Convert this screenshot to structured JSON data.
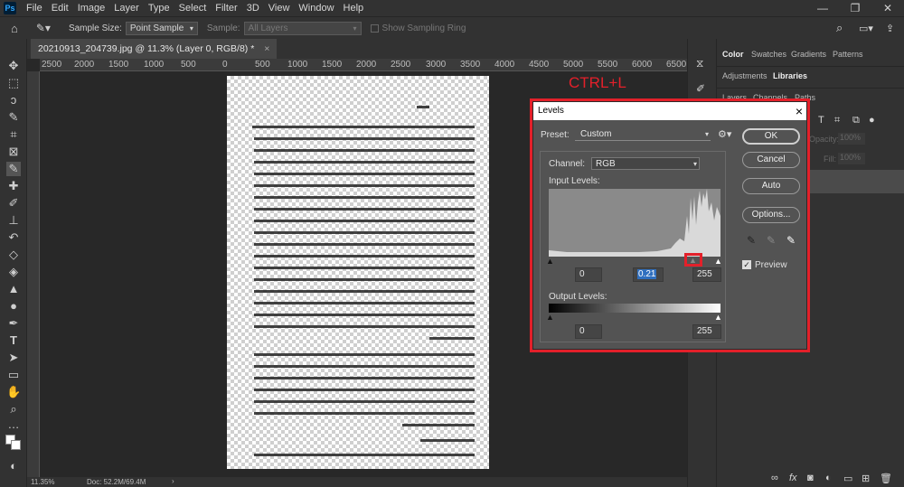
{
  "menubar": {
    "app_logo": "Ps",
    "items": [
      "File",
      "Edit",
      "Image",
      "Layer",
      "Type",
      "Select",
      "Filter",
      "3D",
      "View",
      "Window",
      "Help"
    ],
    "window_controls": [
      "—",
      "❐",
      "✕"
    ]
  },
  "options_bar": {
    "sample_size_label": "Sample Size:",
    "sample_size_value": "Point Sample",
    "sample_label": "Sample:",
    "sample_value": "All Layers",
    "show_ring_label": "Show Sampling Ring"
  },
  "document": {
    "tab_title": "20210913_204739.jpg @ 11.3% (Layer 0, RGB/8) *",
    "ruler_ticks": [
      "2500",
      "2000",
      "1500",
      "1000",
      "500",
      "0",
      "500",
      "1000",
      "1500",
      "2000",
      "2500",
      "3000",
      "3500",
      "4000",
      "4500",
      "5000",
      "5500",
      "6000",
      "6500"
    ],
    "zoom": "11.35%",
    "doc_size": "Doc: 52.2M/69.4M"
  },
  "annotation": {
    "shortcut": "CTRL+L"
  },
  "panels": {
    "top_tabs": [
      "Color",
      "Swatches",
      "Gradients",
      "Patterns"
    ],
    "second_tabs": [
      "Adjustments",
      "Libraries"
    ],
    "layer_tabs": [
      "Layers",
      "Channels",
      "Paths"
    ],
    "opacity_label": "Opacity:",
    "opacity_value": "100%",
    "fill_label": "Fill:",
    "fill_value": "100%"
  },
  "levels_dialog": {
    "title": "Levels",
    "preset_label": "Preset:",
    "preset_value": "Custom",
    "channel_label": "Channel:",
    "channel_value": "RGB",
    "input_levels_label": "Input Levels:",
    "input_black": "0",
    "input_gray": "0.21",
    "input_white": "255",
    "output_levels_label": "Output Levels:",
    "output_black": "0",
    "output_white": "255",
    "buttons": {
      "ok": "OK",
      "cancel": "Cancel",
      "auto": "Auto",
      "options": "Options..."
    },
    "preview_label": "Preview",
    "preview_checked": true
  }
}
